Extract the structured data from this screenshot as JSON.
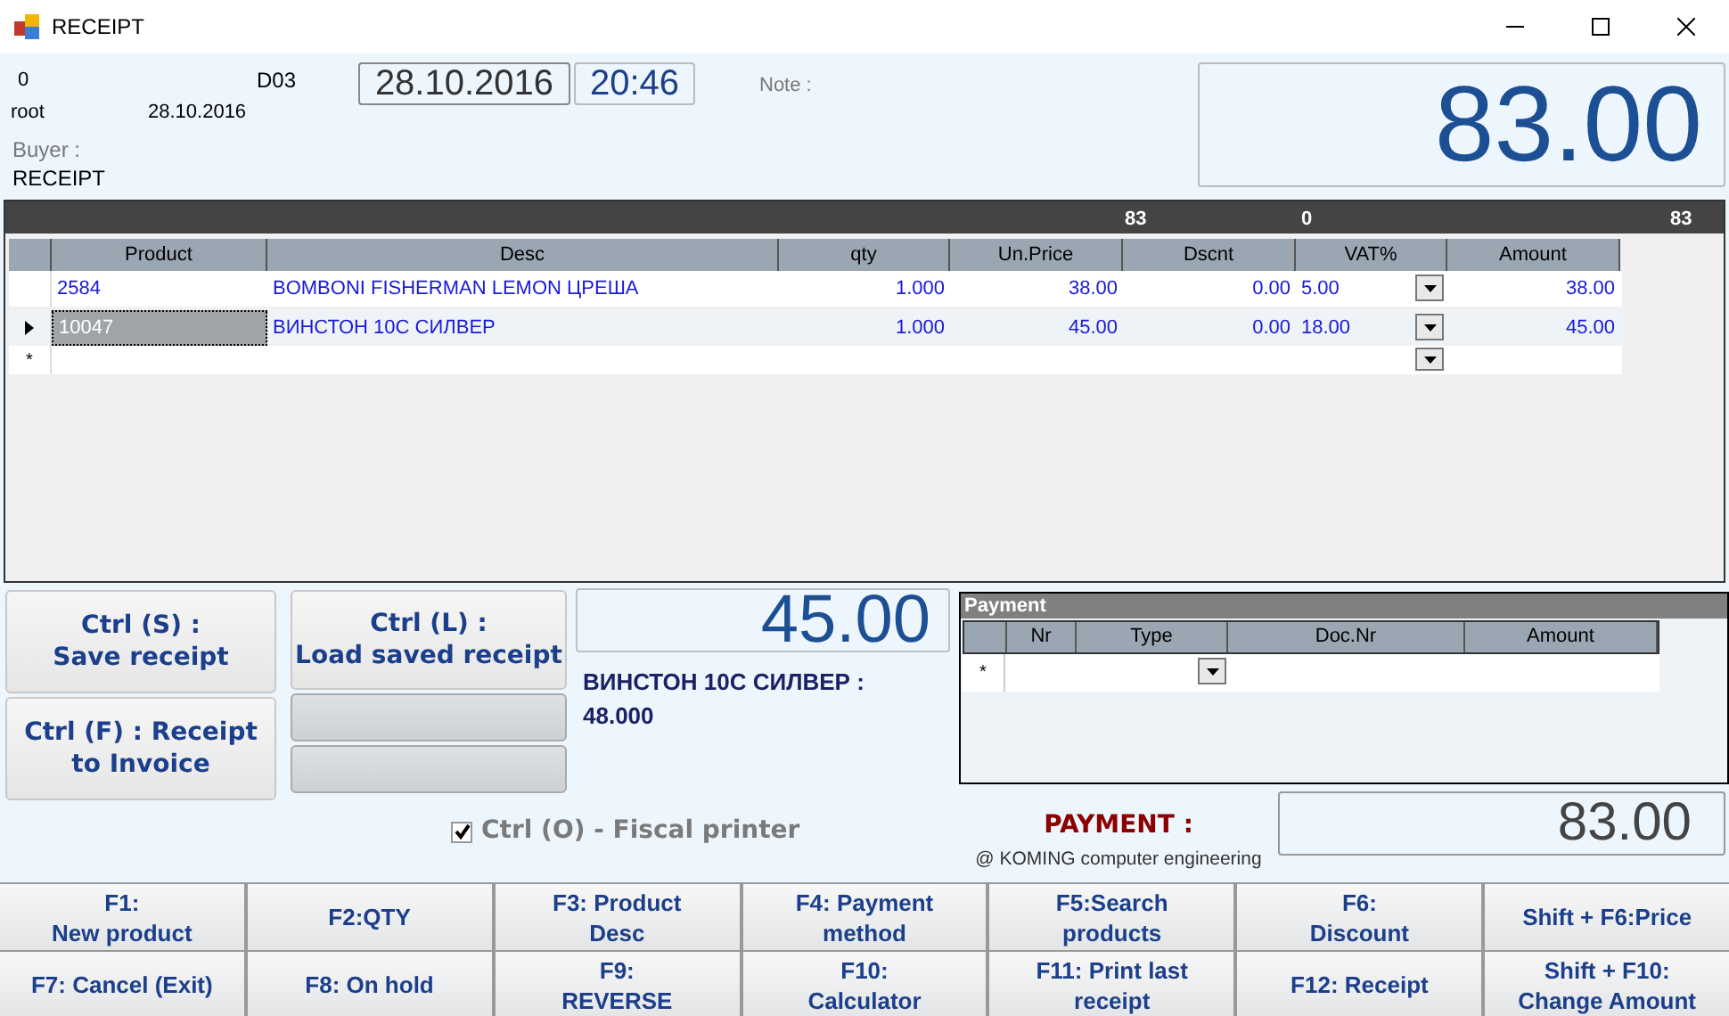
{
  "window": {
    "title": "RECEIPT"
  },
  "header": {
    "number": "0",
    "station": "D03",
    "user": "root",
    "doc_date": "28.10.2016",
    "buyer_label": "Buyer :",
    "buyer": "RECEIPT",
    "date": "28.10.2016",
    "time": "20:46",
    "note_label": "Note :",
    "total": "83.00"
  },
  "grid": {
    "totals": [
      "83",
      "0",
      "83"
    ],
    "columns": [
      "Product",
      "Desc",
      "qty",
      "Un.Price",
      "Dscnt",
      "VAT%",
      "Amount"
    ],
    "rows": [
      {
        "selected": false,
        "product": "2584",
        "desc": "BOMBONI FISHERMAN LEMON ЦРЕША",
        "qty": "1.000",
        "price": "38.00",
        "discount": "0.00",
        "vat": "5.00",
        "amount": "38.00"
      },
      {
        "selected": true,
        "product": "10047",
        "desc": "ВИНСТОН 10С СИЛВЕР",
        "qty": "1.000",
        "price": "45.00",
        "discount": "0.00",
        "vat": "18.00",
        "amount": "45.00"
      }
    ],
    "new_row_marker": "*"
  },
  "left_buttons": [
    {
      "label": "Ctrl (S) :\nSave receipt"
    },
    {
      "label": "Ctrl (F) : Receipt\nto Invoice"
    }
  ],
  "middle_buttons": [
    {
      "label": "Ctrl (L) :\nLoad saved receipt",
      "disabled": false
    },
    {
      "disabled": true
    },
    {
      "disabled": true
    }
  ],
  "current_item": {
    "price": "45.00",
    "text": "ВИНСТОН 10С СИЛВЕР  :\n48.000"
  },
  "fiscal_printer": {
    "label": "Ctrl (O) - Fiscal printer",
    "checked": true
  },
  "payment": {
    "title": "Payment",
    "columns": [
      "Nr",
      "Type",
      "Doc.Nr",
      "Amount"
    ],
    "new_row_marker": "*",
    "label": "PAYMENT :",
    "credit": "@ KOMING computer engineering",
    "total": "83.00"
  },
  "function_keys": [
    {
      "label": "F1:\nNew product"
    },
    {
      "label": "F2:QTY"
    },
    {
      "label": "F3: Product\nDesc"
    },
    {
      "label": "F4: Payment\nmethod"
    },
    {
      "label": "F5:Search\nproducts"
    },
    {
      "label": "F6:\nDiscount"
    },
    {
      "label": "Shift + F6:Price"
    },
    {
      "label": "F7: Cancel (Exit)"
    },
    {
      "label": "F8: On hold"
    },
    {
      "label": "F9:\nREVERSE"
    },
    {
      "label": "F10:\nCalculator"
    },
    {
      "label": "F11: Print last\nreceipt"
    },
    {
      "label": "F12: Receipt"
    },
    {
      "label": "Shift + F10:\nChange Amount"
    }
  ]
}
